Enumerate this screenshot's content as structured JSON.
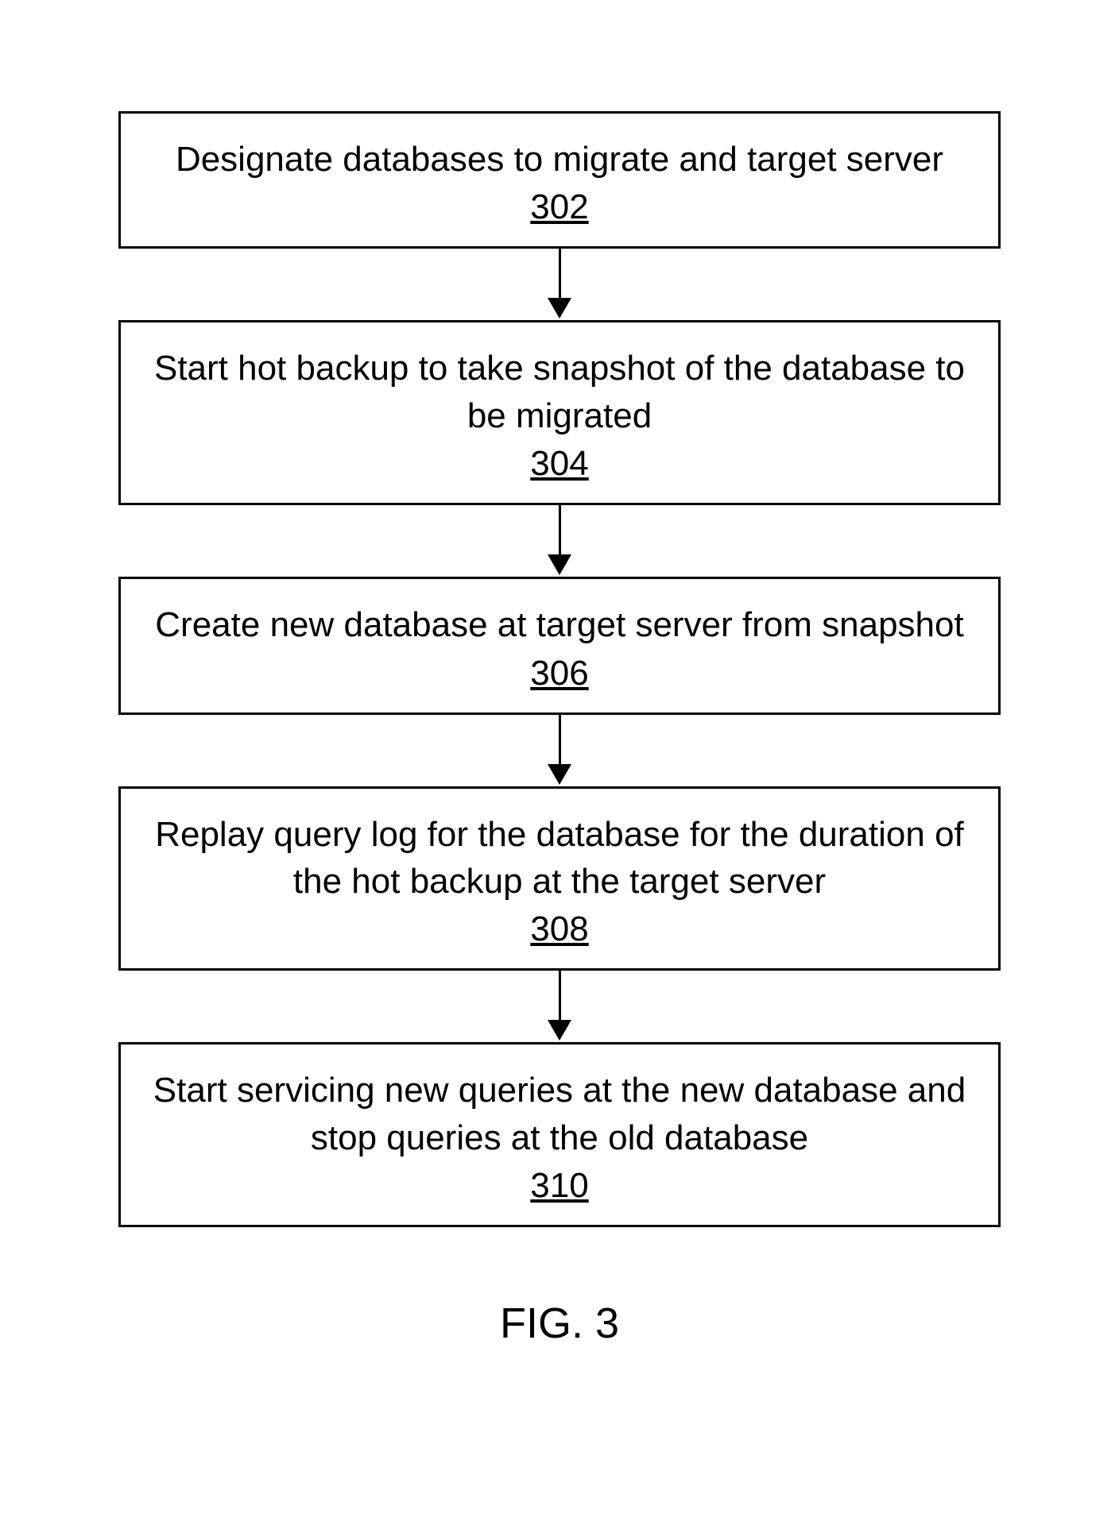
{
  "flowchart": {
    "steps": [
      {
        "text": "Designate databases to migrate and target server",
        "ref": "302"
      },
      {
        "text": "Start hot backup to take snapshot of the database to be migrated",
        "ref": "304"
      },
      {
        "text": "Create new database at target server from snapshot",
        "ref": "306"
      },
      {
        "text": "Replay query log for the database for the duration of the hot backup at the target server",
        "ref": "308"
      },
      {
        "text": "Start servicing new queries at the new database and stop queries at the old database",
        "ref": "310"
      }
    ]
  },
  "figure_label": "FIG. 3"
}
